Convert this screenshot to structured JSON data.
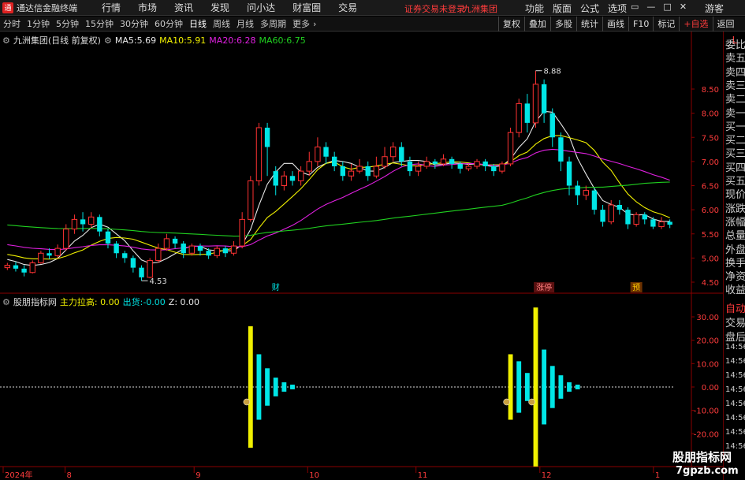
{
  "window": {
    "app_title": "通达信金融终端",
    "menu": [
      "行情",
      "市场",
      "资讯",
      "发现",
      "问小达",
      "财富圈",
      "交易"
    ],
    "login_status": "证券交易未登录",
    "stock_tag": "九洲集团",
    "right_menu": [
      "功能",
      "版面",
      "公式",
      "选项"
    ],
    "guest": "游客"
  },
  "toolbar": {
    "periods": [
      "分时",
      "1分钟",
      "5分钟",
      "15分钟",
      "30分钟",
      "60分钟",
      "日线",
      "周线",
      "月线",
      "多周期",
      "更多"
    ],
    "active_period": "日线",
    "tools": [
      "复权",
      "叠加",
      "多股",
      "统计",
      "画线",
      "F10",
      "标记",
      "+自选",
      "返回"
    ]
  },
  "main_chart": {
    "stock_name": "九洲集团(日线 前复权)",
    "ma": [
      {
        "label": "MA5:",
        "value": "5.69",
        "color": "#e8e8e8"
      },
      {
        "label": "MA10:",
        "value": "5.91",
        "color": "#f0f000"
      },
      {
        "label": "MA20:",
        "value": "6.28",
        "color": "#e020e0"
      },
      {
        "label": "MA60:",
        "value": "6.75",
        "color": "#20d020"
      }
    ],
    "price_axis": [
      "8.50",
      "8.00",
      "7.50",
      "7.00",
      "6.50",
      "6.00",
      "5.50",
      "5.00",
      "4.50"
    ],
    "high_marker": "8.88",
    "low_marker": "4.53",
    "event_tags": [
      "财",
      "涨停",
      "预"
    ]
  },
  "indicator": {
    "name": "股朋指标网",
    "fields": [
      {
        "label": "主力拉高:",
        "value": "0.00",
        "color": "#f0f000"
      },
      {
        "label": "出货:",
        "value": "-0.00",
        "color": "#00e0e0"
      },
      {
        "label": "Z:",
        "value": "0.00",
        "color": "#e8e8e8"
      }
    ],
    "axis": [
      "30.00",
      "20.00",
      "10.00",
      "0.00",
      "-10.00",
      "-20.00"
    ]
  },
  "time_axis": [
    "2024年",
    "8",
    "9",
    "10",
    "11",
    "12",
    "1"
  ],
  "sidebar": {
    "top": "L",
    "items": [
      "委比",
      "卖五",
      "卖四",
      "卖三",
      "卖二",
      "卖一",
      "买一",
      "买二",
      "买三",
      "买四",
      "买五",
      "现价",
      "涨跌",
      "涨幅",
      "总量",
      "外盘",
      "换手",
      "净资",
      "收益",
      "自动",
      "交易",
      "盘后",
      "14:56",
      "14:56",
      "14:56",
      "14:56",
      "14:56",
      "14:56",
      "14:56",
      "14:56"
    ]
  },
  "watermark": {
    "line1": "股朋指标网",
    "line2": "7gpzb.com"
  },
  "chart_data": {
    "type": "candlestick",
    "ylim": [
      4.4,
      9.0
    ],
    "candles": [
      [
        4.8,
        4.85,
        4.75,
        4.9
      ],
      [
        4.85,
        4.78,
        4.72,
        4.92
      ],
      [
        4.78,
        4.7,
        4.62,
        4.85
      ],
      [
        4.7,
        4.9,
        4.68,
        4.95
      ],
      [
        4.9,
        5.1,
        4.88,
        5.15
      ],
      [
        5.1,
        5.05,
        4.98,
        5.2
      ],
      [
        5.05,
        5.2,
        5.0,
        5.28
      ],
      [
        5.2,
        5.6,
        5.15,
        5.7
      ],
      [
        5.6,
        5.8,
        5.5,
        5.9
      ],
      [
        5.8,
        5.7,
        5.55,
        5.95
      ],
      [
        5.7,
        5.85,
        5.62,
        5.95
      ],
      [
        5.85,
        5.55,
        5.45,
        5.9
      ],
      [
        5.55,
        5.3,
        5.2,
        5.6
      ],
      [
        5.3,
        5.1,
        5.0,
        5.35
      ],
      [
        5.1,
        5.0,
        4.9,
        5.15
      ],
      [
        5.0,
        4.8,
        4.7,
        5.05
      ],
      [
        4.8,
        4.6,
        4.53,
        4.85
      ],
      [
        4.6,
        4.95,
        4.58,
        5.0
      ],
      [
        4.95,
        5.2,
        4.9,
        5.3
      ],
      [
        5.2,
        5.4,
        5.15,
        5.5
      ],
      [
        5.4,
        5.3,
        5.2,
        5.45
      ],
      [
        5.3,
        5.1,
        5.0,
        5.35
      ],
      [
        5.1,
        5.25,
        5.05,
        5.3
      ],
      [
        5.25,
        5.15,
        5.05,
        5.3
      ],
      [
        5.15,
        5.05,
        4.98,
        5.2
      ],
      [
        5.05,
        5.2,
        5.0,
        5.25
      ],
      [
        5.2,
        5.1,
        5.02,
        5.25
      ],
      [
        5.1,
        5.25,
        5.05,
        5.35
      ],
      [
        5.25,
        5.8,
        5.2,
        5.95
      ],
      [
        5.8,
        6.6,
        5.75,
        6.7
      ],
      [
        6.6,
        7.7,
        6.5,
        7.8
      ],
      [
        7.7,
        7.3,
        6.7,
        7.8
      ],
      [
        6.8,
        6.5,
        6.3,
        6.9
      ],
      [
        6.5,
        6.7,
        6.4,
        6.8
      ],
      [
        6.7,
        6.6,
        6.5,
        6.8
      ],
      [
        6.6,
        6.8,
        6.5,
        6.9
      ],
      [
        6.8,
        7.0,
        6.7,
        7.2
      ],
      [
        7.0,
        7.3,
        6.9,
        7.5
      ],
      [
        7.3,
        7.1,
        6.95,
        7.4
      ],
      [
        7.1,
        6.9,
        6.8,
        7.2
      ],
      [
        6.9,
        6.7,
        6.6,
        7.0
      ],
      [
        6.7,
        6.8,
        6.6,
        6.95
      ],
      [
        6.8,
        6.9,
        6.75,
        7.05
      ],
      [
        6.9,
        6.7,
        6.6,
        7.0
      ],
      [
        6.7,
        6.9,
        6.65,
        7.1
      ],
      [
        6.9,
        7.1,
        6.85,
        7.3
      ],
      [
        7.1,
        7.3,
        7.0,
        7.4
      ],
      [
        7.3,
        7.0,
        6.9,
        7.4
      ],
      [
        7.0,
        6.8,
        6.7,
        7.1
      ],
      [
        6.8,
        6.9,
        6.7,
        7.0
      ],
      [
        6.9,
        7.0,
        6.85,
        7.1
      ],
      [
        7.0,
        6.95,
        6.85,
        7.05
      ],
      [
        6.95,
        7.05,
        6.9,
        7.15
      ],
      [
        7.05,
        6.95,
        6.85,
        7.1
      ],
      [
        6.95,
        6.85,
        6.75,
        7.0
      ],
      [
        6.85,
        6.9,
        6.8,
        6.95
      ],
      [
        6.9,
        7.0,
        6.85,
        7.05
      ],
      [
        7.0,
        6.9,
        6.8,
        7.05
      ],
      [
        6.9,
        6.8,
        6.7,
        6.95
      ],
      [
        6.8,
        6.95,
        6.75,
        7.0
      ],
      [
        6.95,
        7.6,
        6.9,
        7.7
      ],
      [
        7.6,
        8.2,
        7.5,
        8.3
      ],
      [
        8.2,
        7.8,
        7.6,
        8.4
      ],
      [
        7.8,
        8.6,
        7.7,
        8.88
      ],
      [
        8.6,
        8.0,
        7.8,
        8.7
      ],
      [
        8.0,
        7.5,
        7.3,
        8.1
      ],
      [
        7.5,
        7.0,
        6.8,
        7.6
      ],
      [
        7.0,
        6.5,
        6.3,
        7.1
      ],
      [
        6.5,
        6.3,
        6.1,
        6.6
      ],
      [
        6.3,
        6.4,
        6.2,
        6.5
      ],
      [
        6.4,
        6.0,
        5.9,
        6.45
      ],
      [
        6.0,
        5.75,
        5.65,
        6.1
      ],
      [
        5.75,
        6.1,
        5.7,
        6.2
      ],
      [
        6.1,
        6.0,
        5.9,
        6.2
      ],
      [
        6.0,
        5.7,
        5.6,
        6.05
      ],
      [
        5.7,
        5.9,
        5.65,
        5.95
      ],
      [
        5.9,
        5.8,
        5.7,
        5.95
      ],
      [
        5.8,
        5.65,
        5.6,
        5.85
      ],
      [
        5.65,
        5.75,
        5.6,
        5.85
      ],
      [
        5.75,
        5.69,
        5.62,
        5.8
      ]
    ],
    "indicator_bars": [
      {
        "index": 29,
        "yellow": 26,
        "cyan": [
          14,
          8,
          4,
          2,
          1
        ]
      },
      {
        "index": 60,
        "yellow": 14,
        "cyan": [
          11,
          6,
          3,
          1
        ]
      },
      {
        "index": 63,
        "yellow": 34,
        "cyan": [
          16,
          9,
          5,
          2,
          1
        ]
      }
    ]
  }
}
